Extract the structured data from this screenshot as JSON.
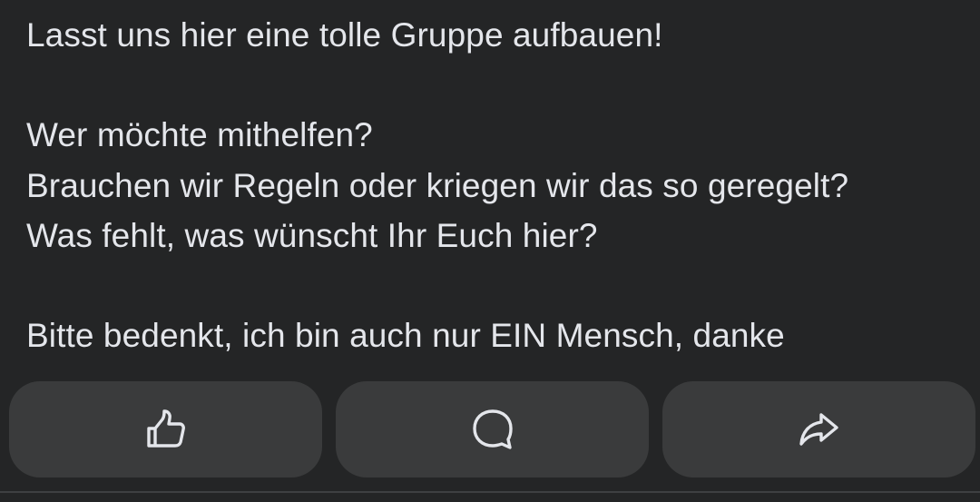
{
  "post": {
    "lines": [
      "Lasst uns hier eine tolle Gruppe aufbauen!",
      "Wer möchte mithelfen?",
      "Brauchen wir Regeln oder kriegen wir das so geregelt?",
      "Was fehlt, was wünscht Ihr Euch hier?",
      "Bitte bedenkt, ich bin auch nur EIN Mensch, danke"
    ]
  },
  "actions": {
    "like_icon": "thumbs-up-icon",
    "comment_icon": "speech-bubble-icon",
    "share_icon": "share-arrow-icon"
  },
  "colors": {
    "background": "#242526",
    "text": "#e4e6eb",
    "button_background": "#3a3b3c",
    "divider": "#3e4042"
  }
}
